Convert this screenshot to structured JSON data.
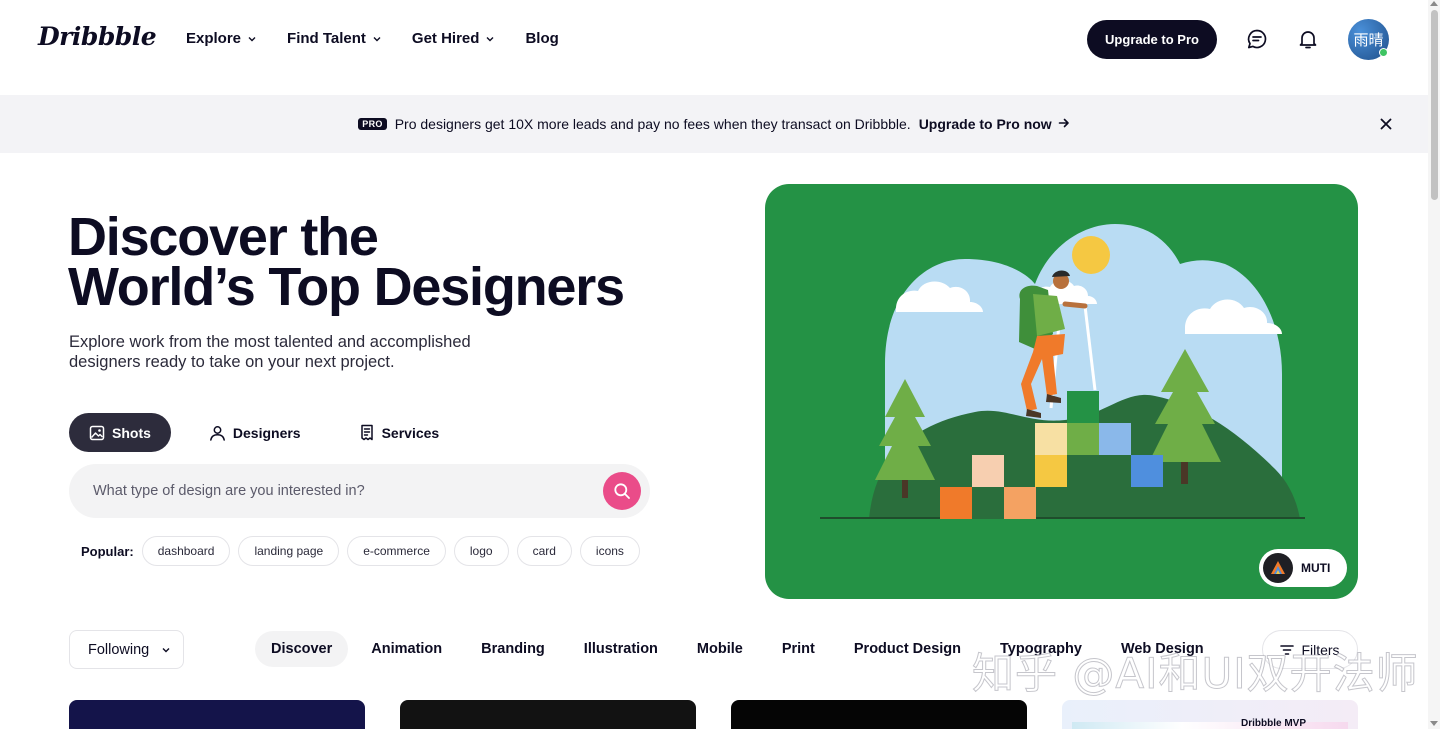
{
  "header": {
    "logo": "Dribbble",
    "nav": [
      {
        "label": "Explore",
        "has_dropdown": true
      },
      {
        "label": "Find Talent",
        "has_dropdown": true
      },
      {
        "label": "Get Hired",
        "has_dropdown": true
      },
      {
        "label": "Blog",
        "has_dropdown": false
      }
    ],
    "upgrade_label": "Upgrade to Pro",
    "avatar_text": "雨晴",
    "icons": [
      "message-icon",
      "bell-icon"
    ]
  },
  "banner": {
    "badge": "PRO",
    "text": "Pro designers get 10X more leads and pay no fees when they transact on Dribbble.",
    "link": "Upgrade to Pro now"
  },
  "hero": {
    "title_line1": "Discover the",
    "title_line2": "World’s Top Designers",
    "subtitle": "Explore work from the most talented and accomplished designers ready to take on your next project.",
    "tabs": [
      "Shots",
      "Designers",
      "Services"
    ],
    "active_tab": "Shots",
    "search_placeholder": "What type of design are you interested in?",
    "popular_label": "Popular:",
    "popular_tags": [
      "dashboard",
      "landing page",
      "e-commerce",
      "logo",
      "card",
      "icons"
    ],
    "featured_author": "MUTI"
  },
  "filter_bar": {
    "following": "Following",
    "categories": [
      "Discover",
      "Animation",
      "Branding",
      "Illustration",
      "Mobile",
      "Print",
      "Product Design",
      "Typography",
      "Web Design"
    ],
    "active_category": "Discover",
    "filters_label": "Filters"
  },
  "cards": {
    "fourth_card_label": "Dribbble MVP"
  },
  "watermark": "知乎 @AI和UI双开法师",
  "colors": {
    "brand_pink": "#ea4c89",
    "dark": "#0d0c22",
    "illustration_green": "#249245"
  }
}
